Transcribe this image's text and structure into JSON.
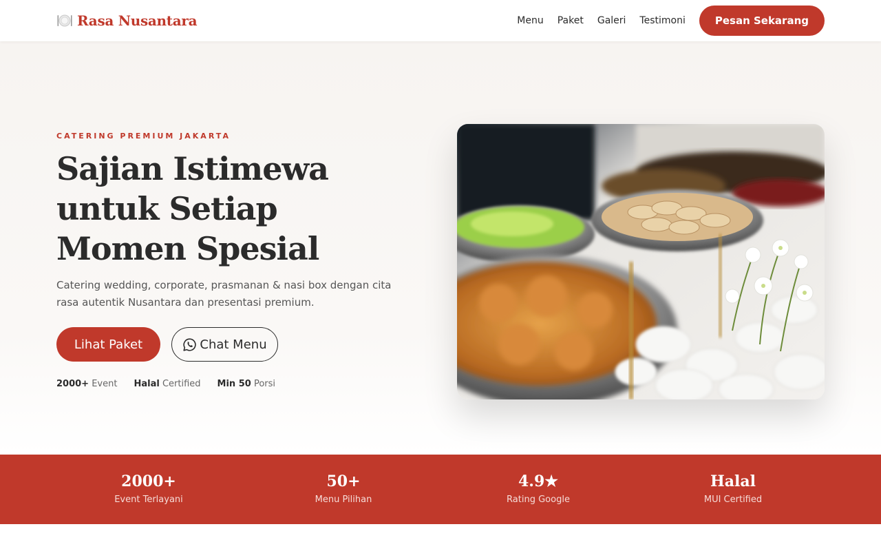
{
  "nav": {
    "brand_icon": "plate-cutlery-icon",
    "brand": "Rasa Nusantara",
    "links": [
      "Menu",
      "Paket",
      "Galeri",
      "Testimoni"
    ],
    "cta": "Pesan Sekarang"
  },
  "hero": {
    "eyebrow": "CATERING PREMIUM JAKARTA",
    "headline_lines": [
      "Sajian Istimewa",
      "untuk Setiap",
      "Momen Spesial"
    ],
    "subtitle": "Catering wedding, corporate, prasmanan & nasi box dengan cita rasa autentik Nusantara dan presentasi premium.",
    "primary_button": "Lihat Paket",
    "secondary_button": "Chat Menu",
    "secondary_icon": "whatsapp-icon",
    "facts": [
      {
        "strong": "2000+",
        "text": "Event"
      },
      {
        "strong": "Halal",
        "text": "Certified"
      },
      {
        "strong": "Min 50",
        "text": "Porsi"
      }
    ],
    "image": "buffet-chafing-dishes-photo"
  },
  "stats": [
    {
      "value": "2000+",
      "label": "Event Terlayani"
    },
    {
      "value": "50+",
      "label": "Menu Pilihan"
    },
    {
      "value": "4.9★",
      "label": "Rating Google"
    },
    {
      "value": "Halal",
      "label": "MUI Certified"
    }
  ],
  "colors": {
    "accent": "#c0392b",
    "text": "#2b2b2b",
    "hero_bg": "#f7f4f1"
  }
}
